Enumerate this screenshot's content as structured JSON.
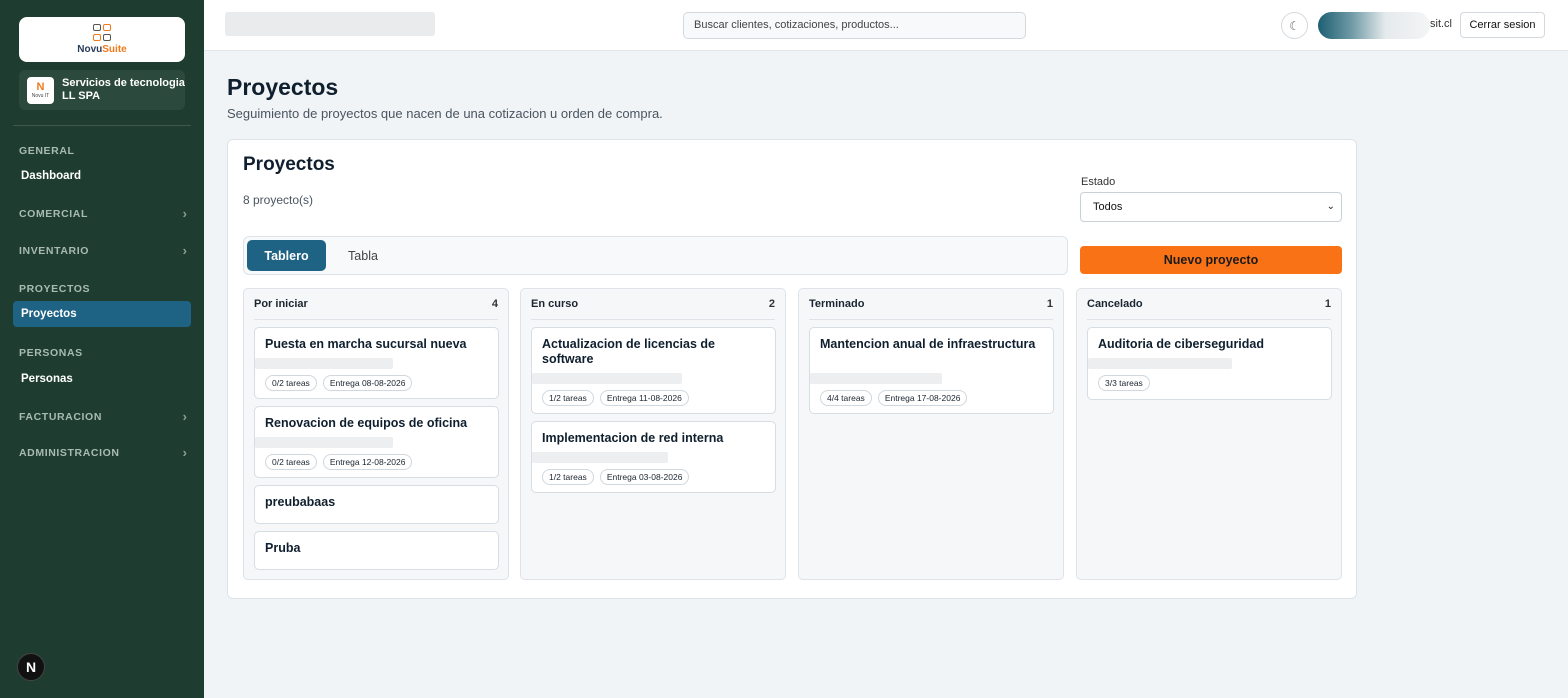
{
  "sidebar": {
    "logo": {
      "brand_a": "Novu",
      "brand_b": "Suite"
    },
    "company": {
      "logo_initial": "N",
      "logo_caption": "Novu IT",
      "name": "Servicios de tecnologia LL SPA"
    },
    "sections": {
      "general": "GENERAL",
      "dashboard": "Dashboard",
      "comercial": "COMERCIAL",
      "inventario": "INVENTARIO",
      "proyectos": "PROYECTOS",
      "proyectos_link": "Proyectos",
      "personas": "PERSONAS",
      "personas_link": "Personas",
      "facturacion": "FACTURACION",
      "administracion": "ADMINISTRACION"
    },
    "bottom_badge": "N"
  },
  "topbar": {
    "search_placeholder": "Buscar clientes, cotizaciones, productos...",
    "theme_icon": "☾",
    "email_suffix": "sit.cl",
    "logout_label": "Cerrar sesion"
  },
  "page": {
    "title": "Proyectos",
    "subtitle": "Seguimiento de proyectos que nacen de una cotizacion u orden de compra."
  },
  "card": {
    "title": "Proyectos",
    "count_text": "8 proyecto(s)",
    "estado_label": "Estado",
    "estado_value": "Todos",
    "tabs": {
      "board": "Tablero",
      "table": "Tabla"
    },
    "new_button": "Nuevo proyecto"
  },
  "board": {
    "columns": [
      {
        "name": "Por iniciar",
        "count": "4",
        "items": [
          {
            "title": "Puesta en marcha sucursal nueva",
            "tasks": "0/2 tareas",
            "due": "Entrega 08-08-2026"
          },
          {
            "title": "Renovacion de equipos de oficina",
            "tasks": "0/2 tareas",
            "due": "Entrega 12-08-2026"
          },
          {
            "title": "preubabaas"
          },
          {
            "title": "Pruba"
          }
        ]
      },
      {
        "name": "En curso",
        "count": "2",
        "items": [
          {
            "title": "Actualizacion de licencias de software",
            "tasks": "1/2 tareas",
            "due": "Entrega 11-08-2026"
          },
          {
            "title": "Implementacion de red interna",
            "tasks": "1/2 tareas",
            "due": "Entrega 03-08-2026"
          }
        ]
      },
      {
        "name": "Terminado",
        "count": "1",
        "items": [
          {
            "title": "Mantencion anual de infraestructura",
            "tasks": "4/4 tareas",
            "due": "Entrega 17-08-2026"
          }
        ]
      },
      {
        "name": "Cancelado",
        "count": "1",
        "items": [
          {
            "title": "Auditoria de ciberseguridad",
            "tasks": "3/3 tareas"
          }
        ]
      }
    ]
  }
}
